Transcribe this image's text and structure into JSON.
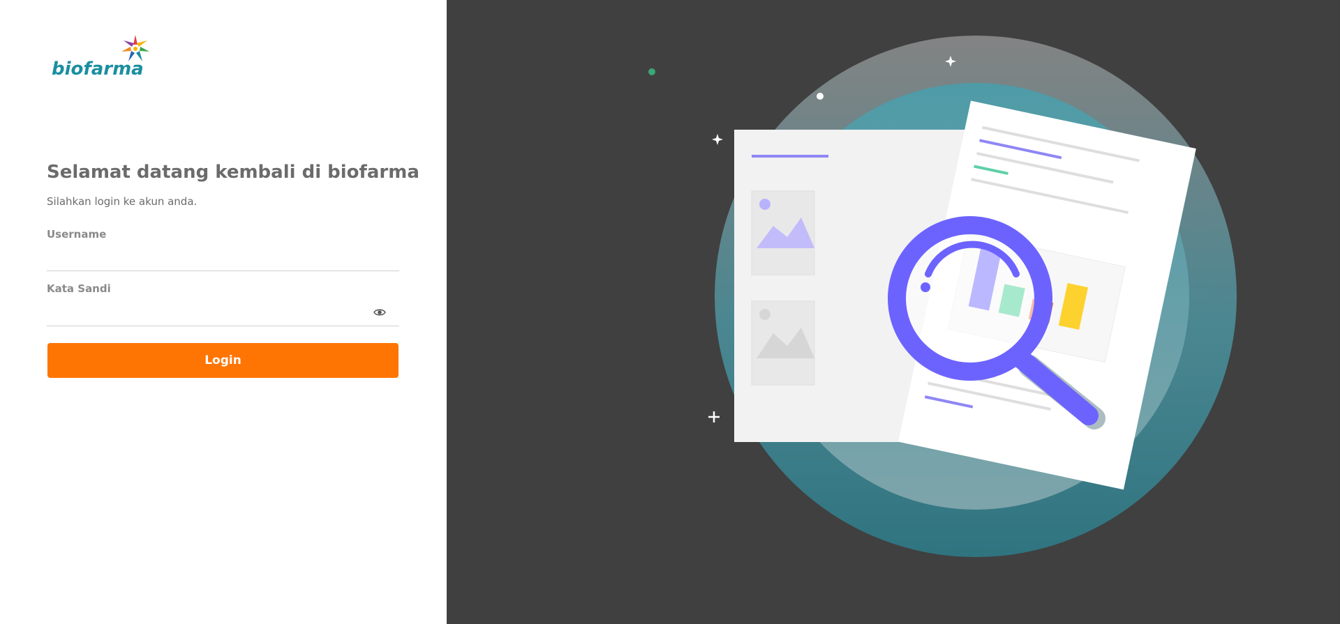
{
  "brand": {
    "name": "biofarma",
    "colors": {
      "teal": "#1b8fa0",
      "orange": "#ff7504",
      "panel_dark": "#404040"
    }
  },
  "login": {
    "heading": "Selamat datang kembali di biofarma",
    "subheading": "Silahkan login ke akun anda.",
    "username_label": "Username",
    "username_value": "",
    "password_label": "Kata Sandi",
    "password_value": "",
    "password_toggle_icon": "eye-icon",
    "submit_label": "Login"
  },
  "illustration": {
    "subject": "document-analysis-icon"
  }
}
